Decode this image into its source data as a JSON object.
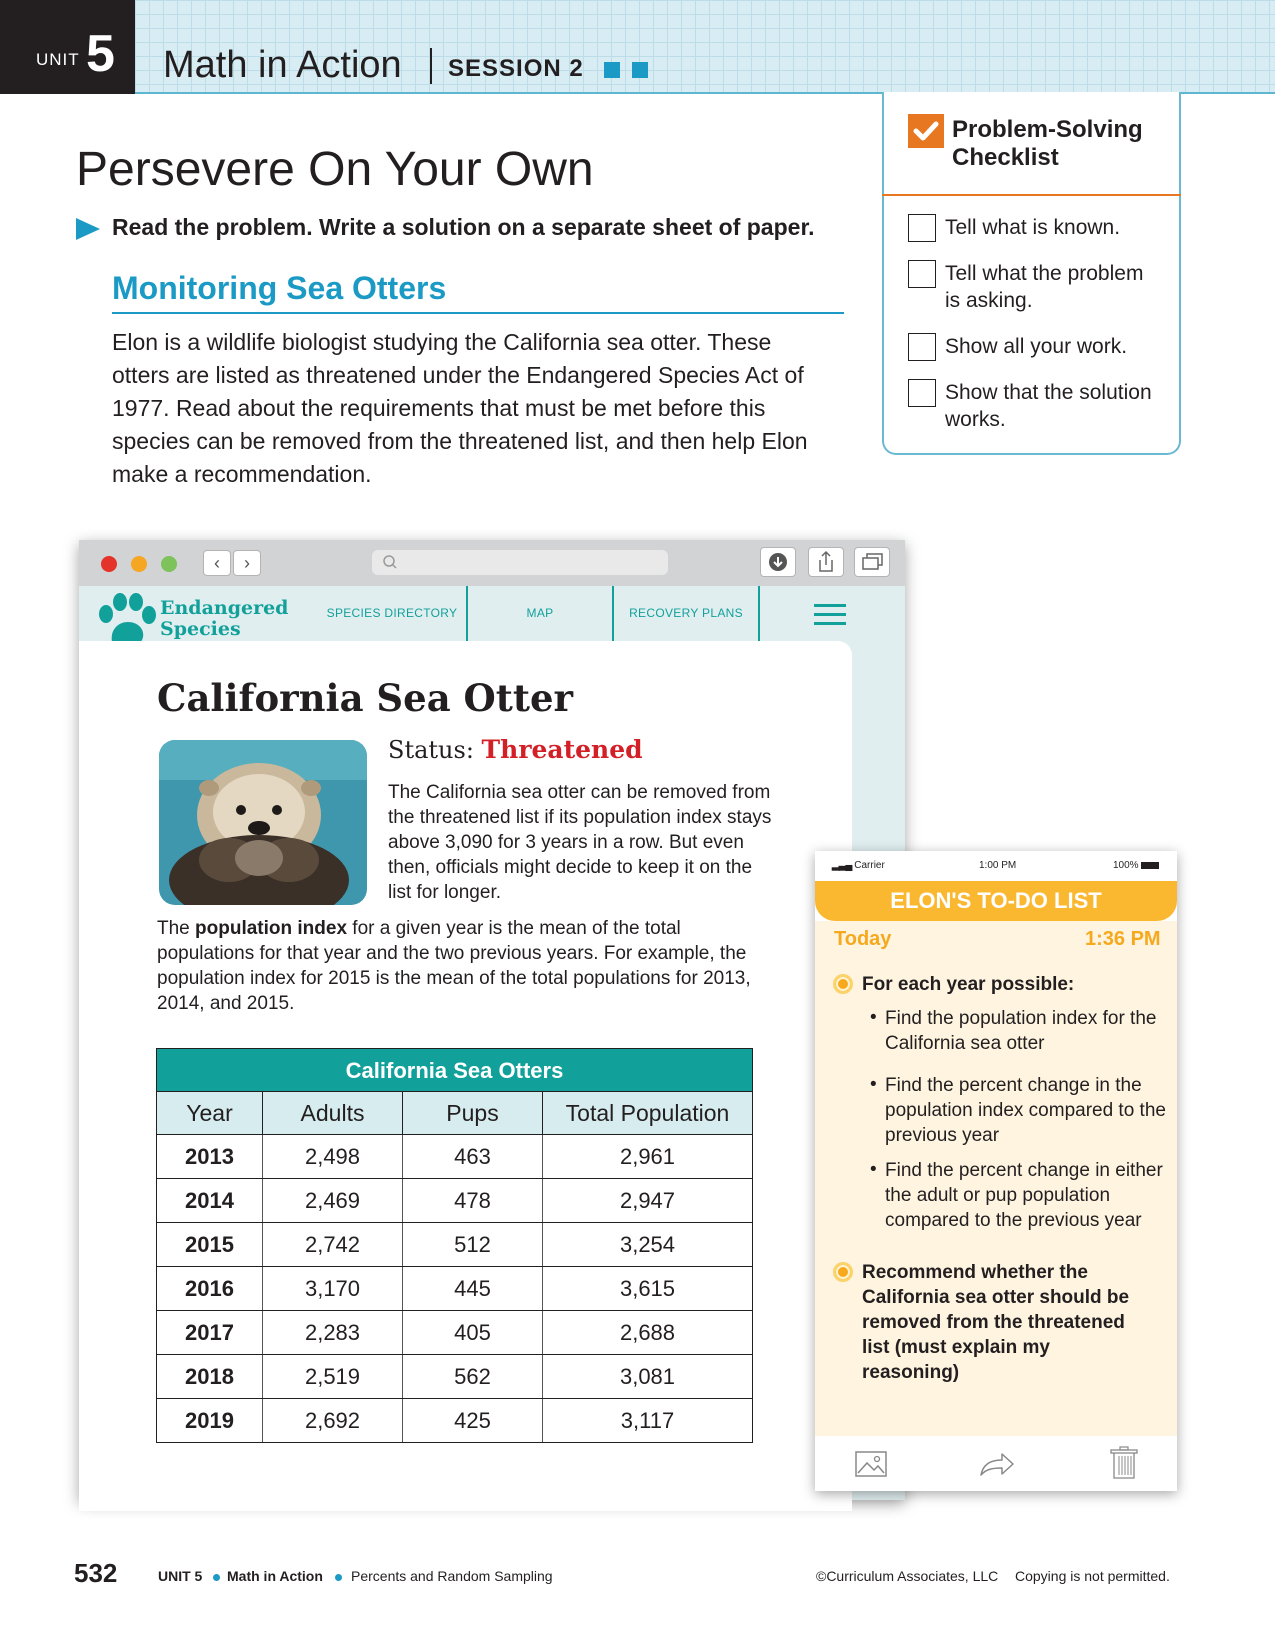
{
  "header": {
    "unit_label": "UNIT",
    "unit_number": "5",
    "title": "Math in Action",
    "session": "SESSION 2",
    "accent": "#1a9ac4"
  },
  "checklist": {
    "title": "Problem-Solving Checklist",
    "items": [
      "Tell what is known.",
      "Tell what the problem is asking.",
      "Show all your work.",
      "Show that the solution works."
    ]
  },
  "problem": {
    "title": "Persevere On Your Own",
    "instruction": "Read the problem. Write a solution on a separate sheet of paper.",
    "heading": "Monitoring Sea Otters",
    "intro": "Elon is a wildlife biologist studying the California sea otter. These otters are listed as threatened under the Endangered Species Act of 1977. Read about the requirements that must be met before this species can be removed from the threatened list, and then help Elon make a recommendation."
  },
  "website": {
    "logo": [
      "Endangered",
      "Species"
    ],
    "nav": [
      "SPECIES DIRECTORY",
      "MAP",
      "RECOVERY PLANS"
    ],
    "species": "California Sea Otter",
    "status_label": "Status:",
    "status_value": "Threatened",
    "status_color": "#d32027",
    "description": "The California sea otter can be removed from the threatened list if its population index stays above 3,090 for 3 years in a row. But even then, officials might decide to keep it on the list for longer.",
    "definition": {
      "before": "The ",
      "term": "population index",
      "after": " for a given year is the mean of the total populations for that year and the two previous years. For example, the population index for 2015 is the mean of the total populations for 2013, 2014, and 2015."
    },
    "table": {
      "caption": "California Sea Otters",
      "headers": [
        "Year",
        "Adults",
        "Pups",
        "Total Population"
      ],
      "rows": [
        [
          "2013",
          "2,498",
          "463",
          "2,961"
        ],
        [
          "2014",
          "2,469",
          "478",
          "2,947"
        ],
        [
          "2015",
          "2,742",
          "512",
          "3,254"
        ],
        [
          "2016",
          "3,170",
          "445",
          "3,615"
        ],
        [
          "2017",
          "2,283",
          "405",
          "2,688"
        ],
        [
          "2018",
          "2,519",
          "562",
          "3,081"
        ],
        [
          "2019",
          "2,692",
          "425",
          "3,117"
        ]
      ]
    }
  },
  "phone": {
    "carrier": "Carrier",
    "clock": "1:00 PM",
    "battery": "100%",
    "title": "ELON'S TO-DO LIST",
    "day": "Today",
    "time": "1:36 PM",
    "task1": "For each year possible:",
    "subtasks": [
      "Find the population index for the California sea otter",
      "Find the percent change in the population index compared to the previous year",
      "Find the percent change in either the adult or pup population compared to the previous year"
    ],
    "task2": "Recommend whether the California sea otter should be removed from the threatened list (must explain my reasoning)",
    "tools": [
      "image-icon",
      "share-arrow-icon",
      "trash-icon"
    ]
  },
  "footer": {
    "page": "532",
    "unit": "UNIT 5",
    "section": "Math in Action",
    "topic": "Percents and Random Sampling",
    "copyright": "©Curriculum Associates, LLC",
    "notice": "Copying is not permitted."
  }
}
